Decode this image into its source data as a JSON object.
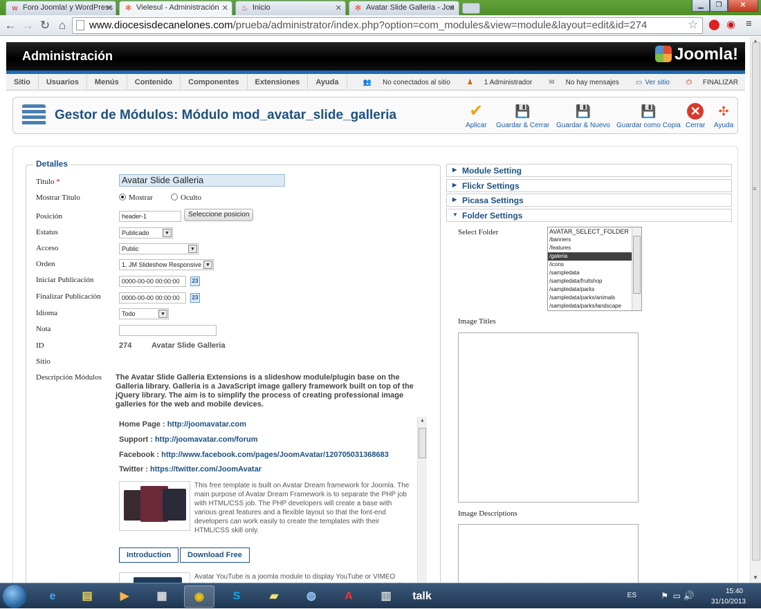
{
  "browser": {
    "tabs": [
      {
        "label": "Foro Joomla! y WordPress",
        "icon": "joomla-forum-favicon"
      },
      {
        "label": "Vielesul - Administración",
        "icon": "joomla-favicon",
        "active": true
      },
      {
        "label": "Inicio",
        "icon": "flame-favicon"
      },
      {
        "label": "Avatar Slide Galleria - Joo",
        "icon": "joomla-favicon"
      }
    ],
    "url_host": "www.diocesisdecanelones.com",
    "url_path": "/prueba/administrator/index.php?option=com_modules&view=module&layout=edit&id=274"
  },
  "header": {
    "title": "Administración",
    "logo": "Joomla!"
  },
  "menu": [
    "Sitio",
    "Usuarios",
    "Menús",
    "Contenido",
    "Componentes",
    "Extensiones",
    "Ayuda"
  ],
  "status": {
    "not_connected": "No conectados al sitio",
    "admins": "1 Administrador",
    "messages": "No hay mensajes",
    "view_site": "Ver sitio",
    "logout": "FINALIZAR"
  },
  "page": {
    "title": "Gestor de Módulos: Módulo mod_avatar_slide_galleria"
  },
  "toolbar": {
    "apply": "Aplicar",
    "save_close": "Guardar & Cerrar",
    "save_new": "Guardar & Nuevo",
    "save_copy": "Guardar como Copia",
    "close": "Cerrar",
    "help": "Ayuda"
  },
  "details": {
    "legend": "Detalles",
    "title_label": "Titulo",
    "title_value": "Avatar Slide Galleria",
    "show_title_label": "Mostrar Titulo",
    "show_option": "Mostrar",
    "hide_option": "Oculto",
    "position_label": "Posición",
    "position_value": "header-1",
    "select_position": "Seleccione posicion",
    "status_label": "Estatus",
    "status_value": "Publicado",
    "access_label": "Acceso",
    "access_value": "Public",
    "order_label": "Orden",
    "order_value": "1. JM Slideshow Responsive",
    "start_label": "Iniciar Publicación",
    "start_value": "0000-00-00 00:00:00",
    "finish_label": "Finalizar Publicación",
    "finish_value": "0000-00-00 00:00:00",
    "language_label": "Idioma",
    "language_value": "Todo",
    "note_label": "Nota",
    "id_label": "ID",
    "id_value": "274",
    "id_name": "Avatar Slide Galleria",
    "site_label": "Sitio",
    "desc_label": "Descripción Módulos",
    "description": "The Avatar Slide Galleria Extensions is a slideshow module/plugin base on the Galleria library. Galleria is a JavaScript image gallery framework built on top of the jQuery library. The aim is to simplify the process of creating professional image galleries for the web and mobile devices."
  },
  "info": {
    "homepage_label": "Home Page :",
    "homepage_url": "http://joomavatar.com",
    "support_label": "Support :",
    "support_url": "http://joomavatar.com/forum",
    "facebook_label": "Facebook :",
    "facebook_url": "http://www.facebook.com/pages/JoomAvatar/120705031368683",
    "twitter_label": "Twitter :",
    "twitter_url": "https://twitter.com/JoomAvatar",
    "promo1": "This free template is built on Avatar Dream framework for Joomla. The main purpose of Avatar Dream Framework is to separate the PHP job with HTML/CSS job. The PHP developers will create a base with various great features and a flexible layout so that the font-end developers can work easily to create the templates with their HTML/CSS skill only.",
    "introduction_btn": "Introduction",
    "download_btn": "Download Free",
    "promo2": "Avatar YouTube is a joomla module to display YouTube or VIMEO video into your website. This module is very easy to use. Just install"
  },
  "panels": {
    "module_setting": "Module Setting",
    "flickr": "Flickr Settings",
    "picasa": "Picasa Settings",
    "folder": "Folder Settings",
    "select_folder_label": "Select Folder",
    "folders": [
      "AVATAR_SELECT_FOLDER",
      "/banners",
      "/features",
      "/galeria",
      "/icons",
      "/sampledata",
      "/sampledata/fruitshop",
      "/sampledata/parks",
      "/sampledata/parks/animals",
      "/sampledata/parks/landscape"
    ],
    "selected_folder": "/galeria",
    "image_titles_label": "Image Titles",
    "image_desc_label": "Image Descriptions"
  },
  "taskbar": {
    "lang": "ES",
    "time": "15:40",
    "date": "31/10/2013"
  },
  "colors": {
    "accent": "#1c5182",
    "header_bg": "#000000",
    "header_stripe": "#1a6db5"
  }
}
